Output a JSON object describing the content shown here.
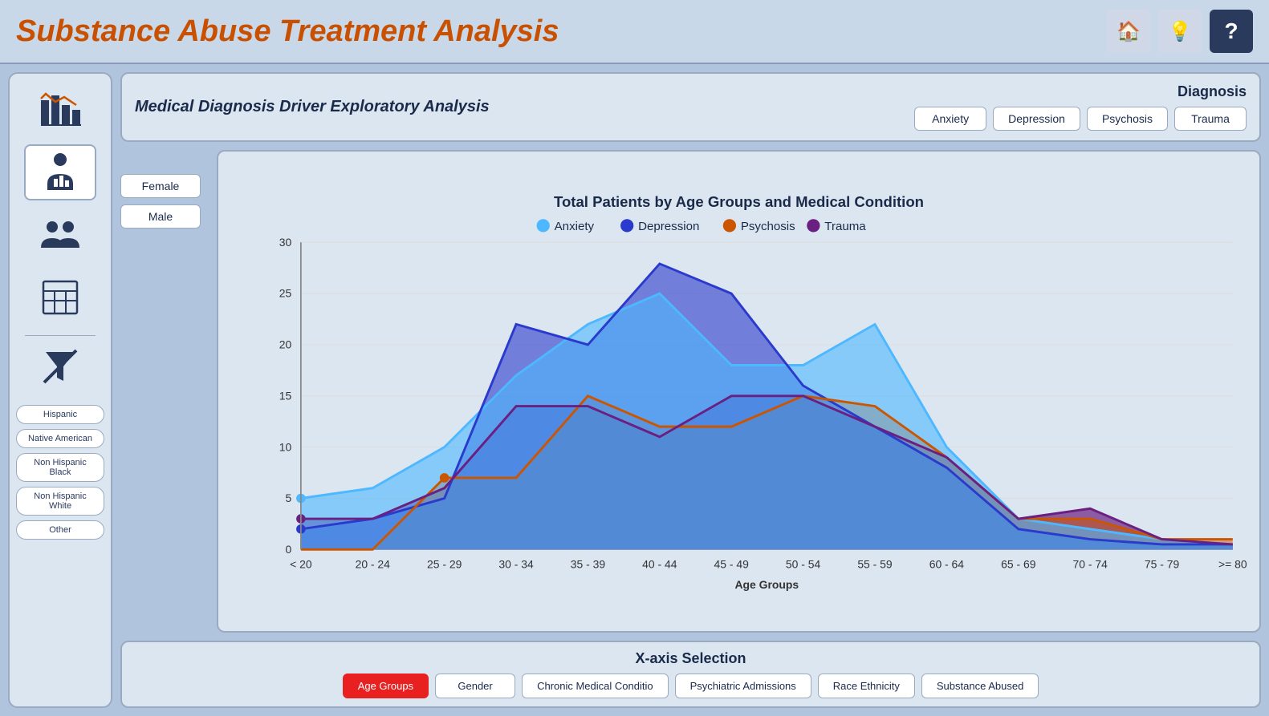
{
  "header": {
    "title": "Substance Abuse Treatment Analysis",
    "icons": [
      {
        "name": "home-icon",
        "symbol": "🏠"
      },
      {
        "name": "lightbulb-icon",
        "symbol": "💡"
      },
      {
        "name": "help-icon",
        "symbol": "?"
      }
    ]
  },
  "sidebar": {
    "icons": [
      {
        "name": "bar-chart-icon",
        "symbol": "📊",
        "active": false
      },
      {
        "name": "person-chart-icon",
        "symbol": "👤",
        "active": true
      },
      {
        "name": "group-icon",
        "symbol": "👥",
        "active": false
      },
      {
        "name": "table-icon",
        "symbol": "⊞",
        "active": false
      }
    ],
    "filter_icon": "🔕",
    "race_filters": [
      {
        "label": "Hispanic",
        "id": "hispanic"
      },
      {
        "label": "Native American",
        "id": "native-american"
      },
      {
        "label": "Non Hispanic Black",
        "id": "non-hispanic-black"
      },
      {
        "label": "Non Hispanic White",
        "id": "non-hispanic-white"
      },
      {
        "label": "Other",
        "id": "other"
      }
    ]
  },
  "diagnosis_card": {
    "title": "Medical Diagnosis Driver Exploratory Analysis",
    "group_label": "Diagnosis",
    "buttons": [
      {
        "label": "Anxiety",
        "id": "anxiety"
      },
      {
        "label": "Depression",
        "id": "depression"
      },
      {
        "label": "Psychosis",
        "id": "psychosis"
      },
      {
        "label": "Trauma",
        "id": "trauma"
      }
    ]
  },
  "gender_buttons": [
    {
      "label": "Female",
      "id": "female"
    },
    {
      "label": "Male",
      "id": "male"
    }
  ],
  "chart": {
    "title": "Total Patients by Age Groups and Medical Condition",
    "x_axis_label": "Age Groups",
    "y_axis_label": "",
    "legend": [
      {
        "label": "Anxiety",
        "color": "#4db8ff"
      },
      {
        "label": "Depression",
        "color": "#2a3acc"
      },
      {
        "label": "Psychosis",
        "color": "#cc5500"
      },
      {
        "label": "Trauma",
        "color": "#6a2080"
      }
    ],
    "x_categories": [
      "< 20",
      "20 - 24",
      "25 - 29",
      "30 - 34",
      "35 - 39",
      "40 - 44",
      "45 - 49",
      "50 - 54",
      "55 - 59",
      "60 - 64",
      "65 - 69",
      "70 - 74",
      "75 - 79",
      ">= 80"
    ],
    "y_ticks": [
      0,
      5,
      10,
      15,
      20,
      25,
      30
    ],
    "series": {
      "anxiety": [
        5,
        6,
        10,
        17,
        22,
        25,
        18,
        18,
        22,
        10,
        3,
        2,
        1,
        0.5
      ],
      "depression": [
        2,
        3,
        5,
        22,
        20,
        27,
        25,
        16,
        12,
        8,
        2,
        1,
        0.5,
        0.5
      ],
      "psychosis": [
        0,
        0,
        7,
        7,
        15,
        12,
        12,
        15,
        14,
        9,
        3,
        3,
        1,
        1
      ],
      "trauma": [
        3,
        3,
        6,
        14,
        14,
        11,
        15,
        15,
        12,
        9,
        3,
        4,
        1,
        0.5
      ]
    }
  },
  "xaxis_selection": {
    "title": "X-axis Selection",
    "buttons": [
      {
        "label": "Age Groups",
        "id": "age-groups",
        "active": true
      },
      {
        "label": "Gender",
        "id": "gender",
        "active": false
      },
      {
        "label": "Chronic Medical Conditio",
        "id": "chronic-medical",
        "active": false
      },
      {
        "label": "Psychiatric Admissions",
        "id": "psychiatric-admissions",
        "active": false
      },
      {
        "label": "Race Ethnicity",
        "id": "race-ethnicity",
        "active": false
      },
      {
        "label": "Substance Abused",
        "id": "substance-abused",
        "active": false
      }
    ]
  }
}
